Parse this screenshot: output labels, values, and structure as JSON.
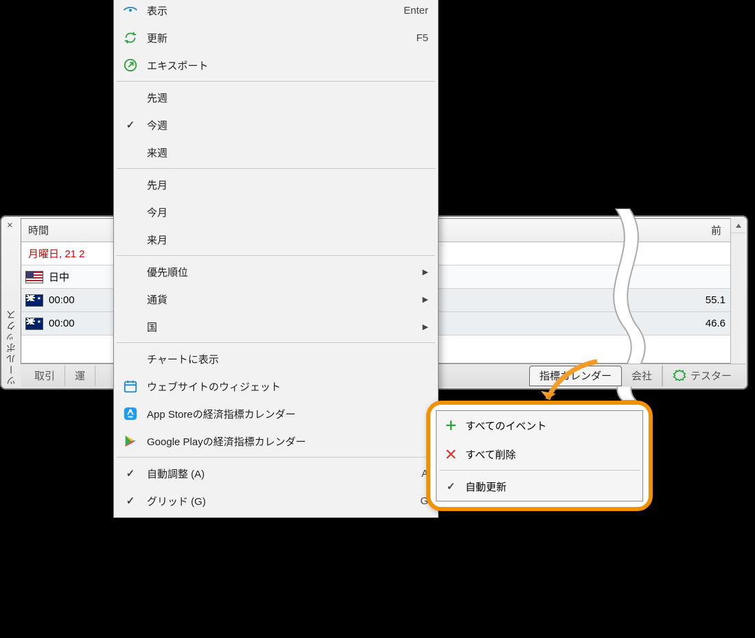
{
  "panel": {
    "side_label": "ツールボックス",
    "close": "×",
    "header_time": "時間",
    "header_prev": "前",
    "date_row": "月曜日, 21 2",
    "rows": [
      {
        "flag": "us",
        "time": "日中",
        "value": ""
      },
      {
        "flag": "au",
        "time": "00:00",
        "value": "55.1"
      },
      {
        "flag": "au",
        "time": "00:00",
        "value": "46.6"
      }
    ],
    "tabs": {
      "trade": "取引",
      "operation": "運",
      "calendar": "指標カレンダー",
      "company": "会社",
      "tester": "テスター"
    }
  },
  "menu": {
    "view": "表示",
    "view_key": "Enter",
    "refresh": "更新",
    "refresh_key": "F5",
    "export": "エキスポート",
    "last_week": "先週",
    "this_week": "今週",
    "next_week": "来週",
    "last_month": "先月",
    "this_month": "今月",
    "next_month": "来月",
    "priority": "優先順位",
    "currency": "通貨",
    "country": "国",
    "chart_show": "チャートに表示",
    "widget": "ウェブサイトのウィジェット",
    "appstore": "App Storeの経済指標カレンダー",
    "playstore": "Google Playの経済指標カレンダー",
    "auto_adjust": "自動調整 (A)",
    "auto_adjust_key": "A",
    "grid": "グリッド (G)",
    "grid_key": "G"
  },
  "popup": {
    "all_events": "すべてのイベント",
    "delete_all": "すべて削除",
    "auto_refresh": "自動更新"
  }
}
